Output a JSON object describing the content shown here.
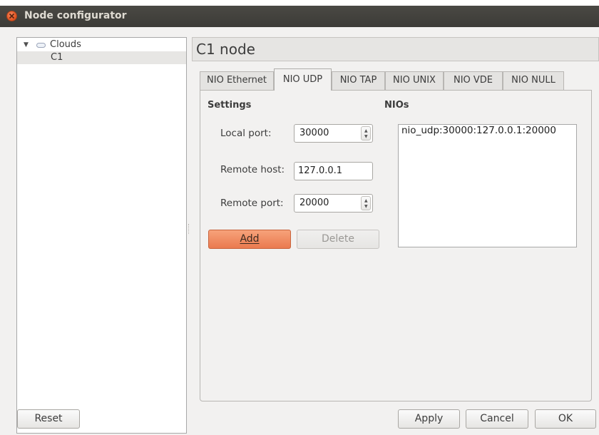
{
  "window": {
    "title": "Node configurator"
  },
  "tree": {
    "parent": {
      "label": "Clouds"
    },
    "child": {
      "label": "C1"
    }
  },
  "node": {
    "title": "C1 node"
  },
  "tabs": [
    {
      "label": "NIO Ethernet"
    },
    {
      "label": "NIO UDP",
      "active": true
    },
    {
      "label": "NIO TAP"
    },
    {
      "label": "NIO UNIX"
    },
    {
      "label": "NIO VDE"
    },
    {
      "label": "NIO NULL"
    }
  ],
  "settings": {
    "title": "Settings",
    "local_port": {
      "label": "Local port:",
      "value": "30000"
    },
    "remote_host": {
      "label": "Remote host:",
      "value": "127.0.0.1"
    },
    "remote_port": {
      "label": "Remote port:",
      "value": "20000"
    },
    "add_label": "Add",
    "delete_label": "Delete"
  },
  "nios": {
    "title": "NIOs",
    "items": [
      "nio_udp:30000:127.0.0.1:20000"
    ]
  },
  "footer": {
    "reset_label": "Reset",
    "apply_label": "Apply",
    "cancel_label": "Cancel",
    "ok_label": "OK"
  },
  "colors": {
    "accent": "#ea7a4f",
    "titlebar": "#3c3b37"
  }
}
